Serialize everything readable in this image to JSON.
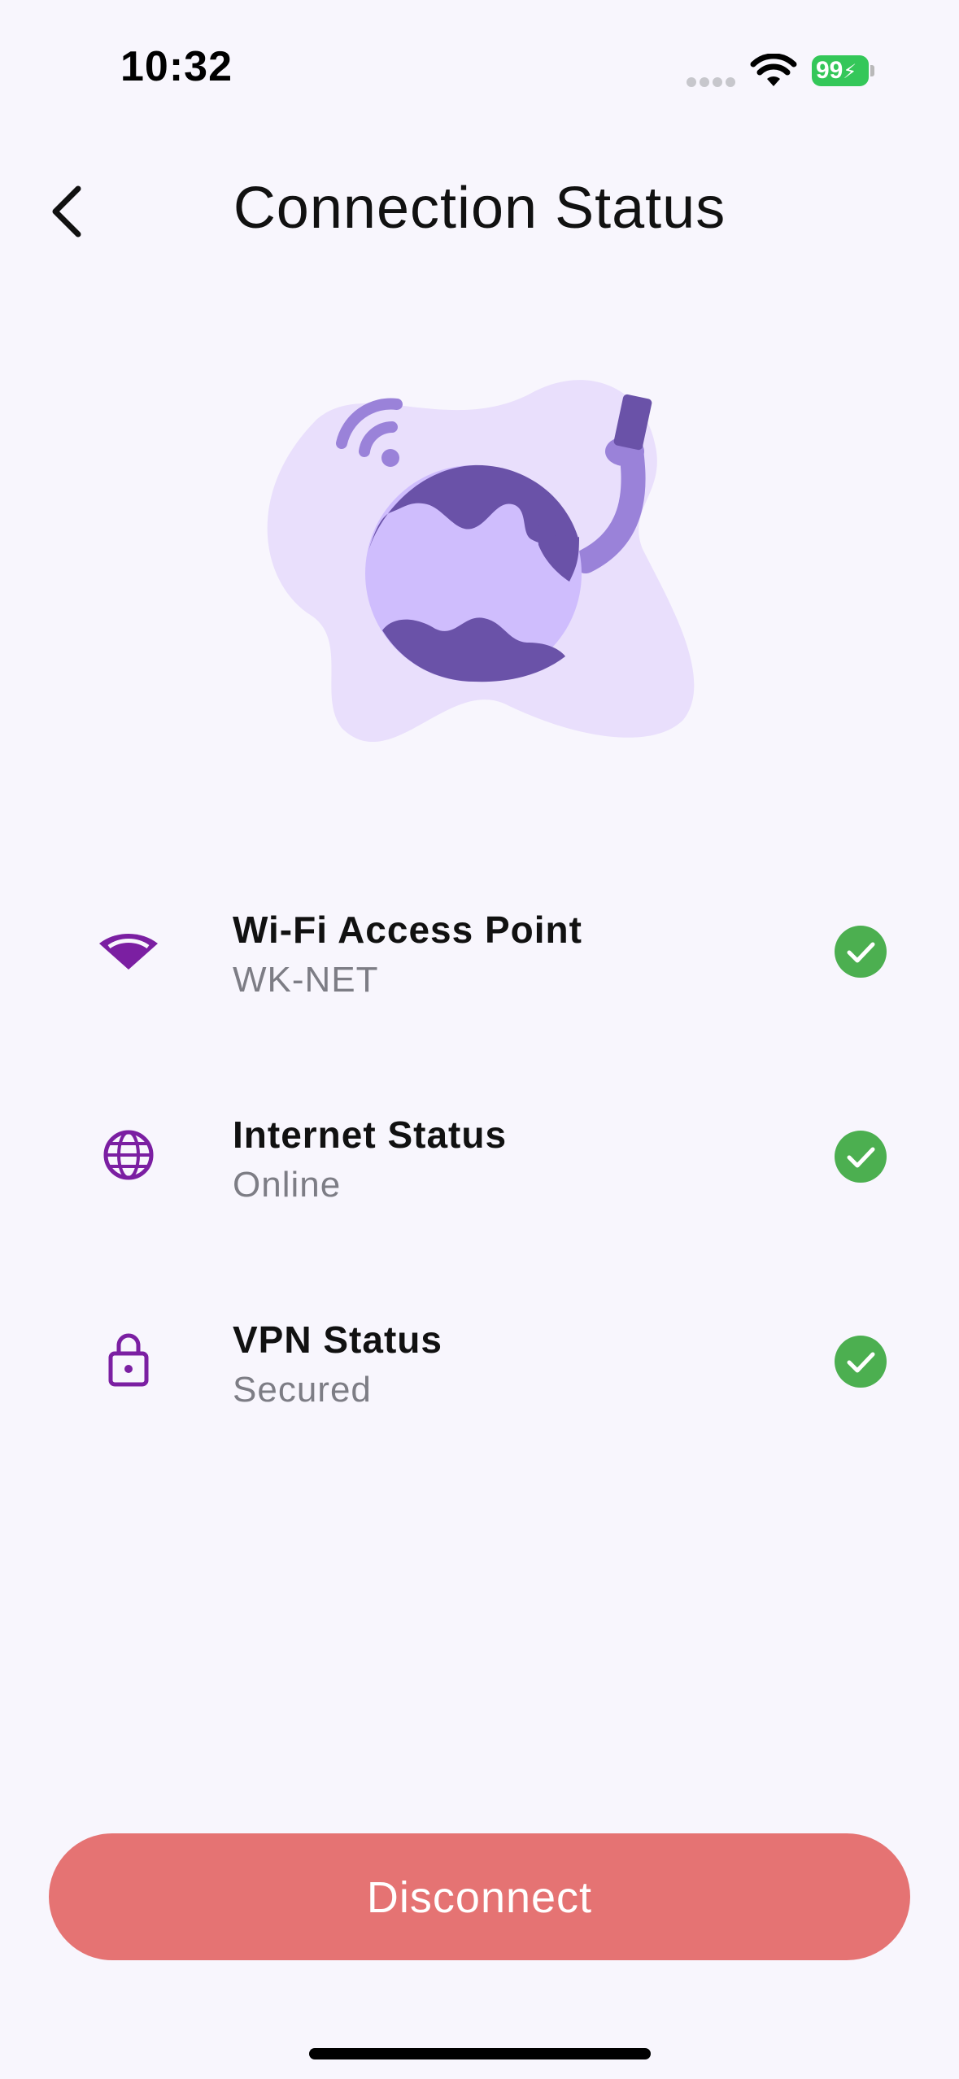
{
  "status_bar": {
    "time": "10:32",
    "battery_level": "99"
  },
  "header": {
    "back_icon": "chevron-left-icon",
    "title": "Connection Status"
  },
  "illustration": {
    "icon": "globe-wifi-illustration",
    "colors": {
      "blob": "#e9dffc",
      "globe": "#cfbdfd",
      "land": "#6a52a8",
      "accent": "#9a82d9"
    }
  },
  "statuses": [
    {
      "icon": "wifi-icon",
      "title": "Wi-Fi Access Point",
      "value": "WK-NET",
      "ok": true
    },
    {
      "icon": "globe-icon",
      "title": "Internet Status",
      "value": "Online",
      "ok": true
    },
    {
      "icon": "lock-icon",
      "title": "VPN Status",
      "value": "Secured",
      "ok": true
    }
  ],
  "actions": {
    "disconnect_label": "Disconnect"
  },
  "colors": {
    "background": "#f8f6fd",
    "icon_purple": "#7b1fa2",
    "check_green": "#4caf50",
    "danger": "#e57373"
  }
}
